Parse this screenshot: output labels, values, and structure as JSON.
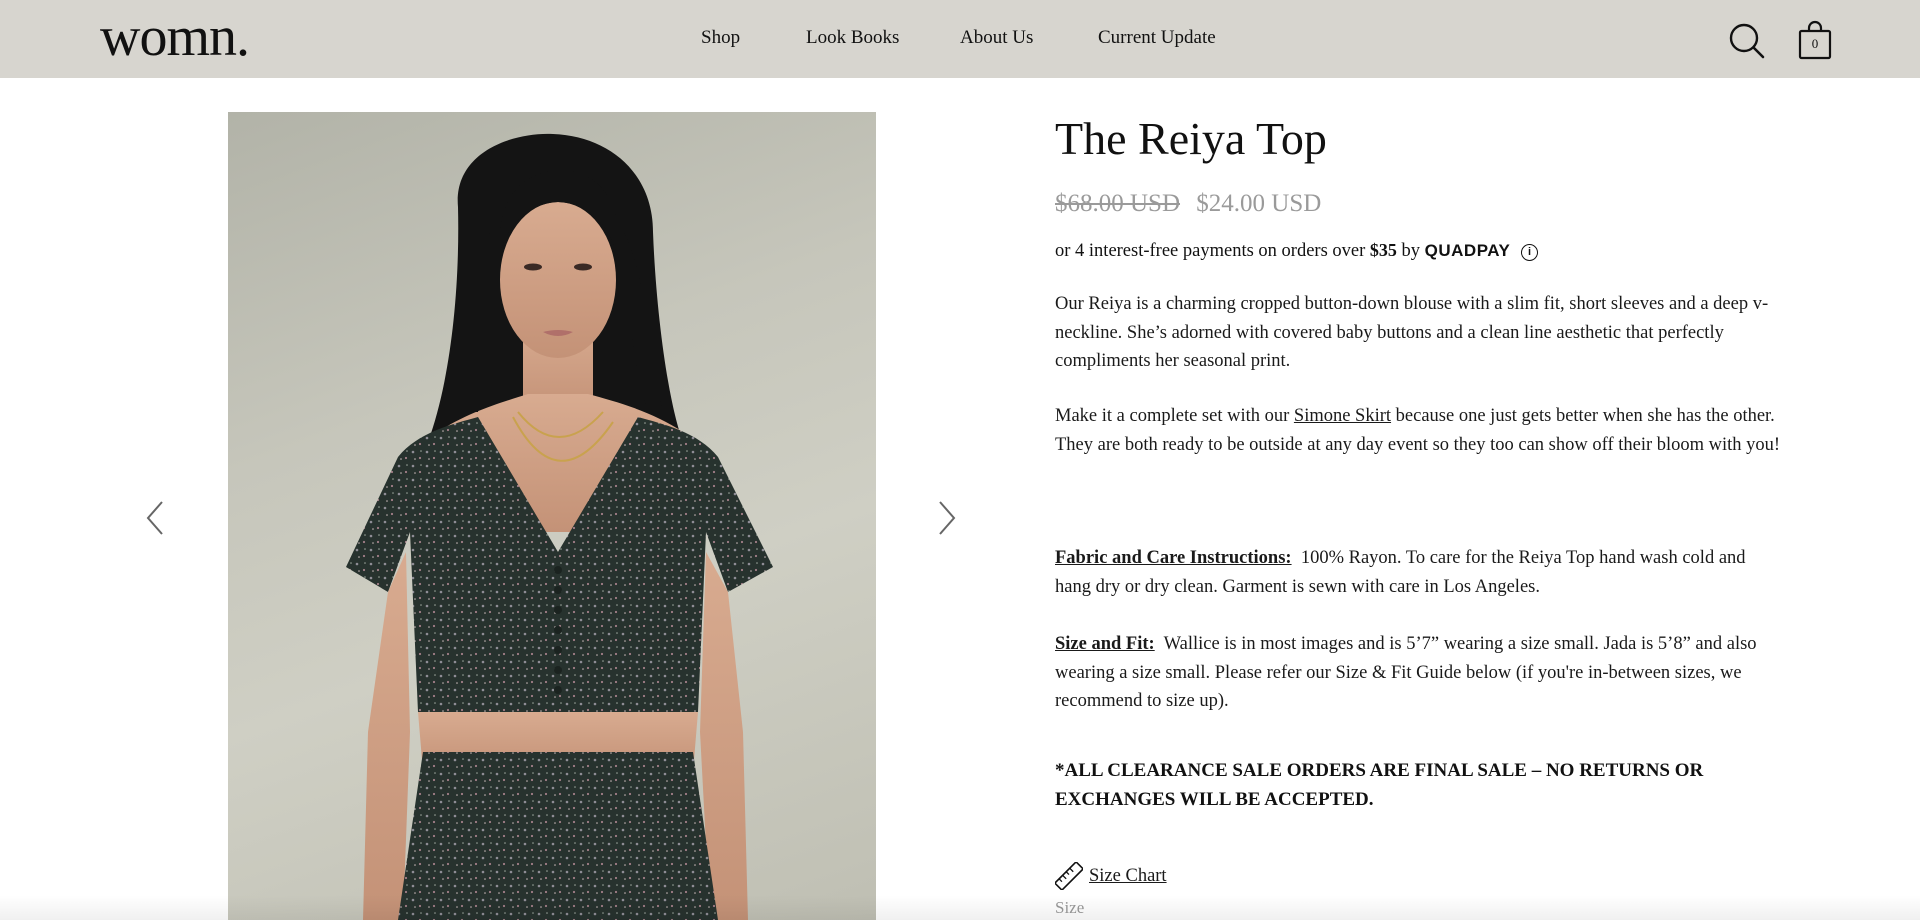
{
  "header": {
    "logo_text": "womn.",
    "nav": [
      {
        "label": "Shop"
      },
      {
        "label": "Look Books"
      },
      {
        "label": "About Us"
      },
      {
        "label": "Current Update"
      }
    ],
    "cart_count": "0",
    "icons": {
      "search": "search-icon",
      "cart": "shopping-bag-icon"
    }
  },
  "gallery": {
    "prev_icon": "chevron-left-icon",
    "next_icon": "chevron-right-icon"
  },
  "product": {
    "title": "The Reiya Top",
    "price_original": "$68.00 USD",
    "price_sale": "$24.00 USD",
    "installments": {
      "prefix": "or 4 interest-free payments on orders over",
      "amount": "$35",
      "by": "by",
      "provider": "QUADPAY",
      "info_glyph": "i"
    },
    "description": "Our Reiya is a charming cropped button-down blouse with a slim fit, short sleeves and a deep v-neckline. She’s adorned with covered baby buttons and a clean line aesthetic that perfectly compliments her seasonal print.",
    "set_text": {
      "before": "Make it a complete set with our",
      "link": "Simone Skirt",
      "after": "because one just gets better when she has the other. They are both ready to be outside at any day event so they too can show off their bloom with you!"
    },
    "fabric": {
      "heading": "Fabric and Care Instructions:",
      "text": "100% Rayon. To care for the Reiya Top hand wash cold and hang dry or dry clean. Garment is sewn with care in Los Angeles."
    },
    "size_fit": {
      "heading": "Size and Fit:",
      "text": "Wallice is in most images and is 5’7” wearing a size small. Jada is 5’8” and also wearing a size small. Please refer our Size & Fit Guide below (if you're in-between sizes, we recommend to size up)."
    },
    "final_sale": "*ALL CLEARANCE SALE ORDERS ARE FINAL SALE – NO RETURNS OR EXCHANGES WILL BE ACCEPTED.",
    "size_chart_label": "Size Chart",
    "size_label": "Size"
  },
  "colors": {
    "header_bg": "#d7d5cf",
    "text": "#1a1a1a",
    "price_muted": "#9a9a9a",
    "top_fabric": "#2a3430",
    "skin": "#c99b80",
    "hair": "#141414"
  }
}
